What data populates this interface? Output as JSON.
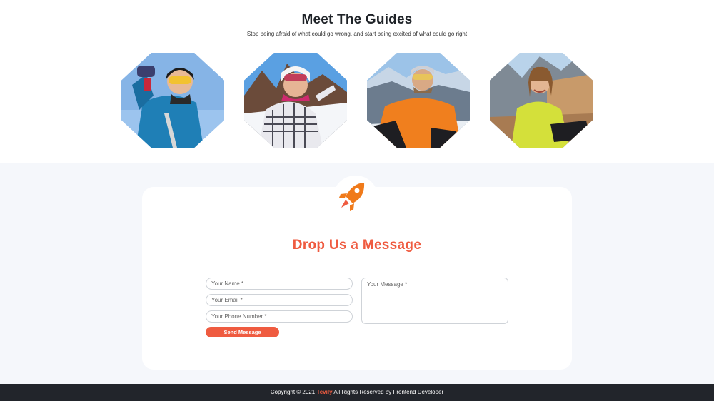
{
  "guides": {
    "title": "Meet The Guides",
    "subtitle": "Stop being afraid of what could go wrong, and start being excited of what could go right",
    "photos": [
      {
        "name": "guide-photo-1"
      },
      {
        "name": "guide-photo-2"
      },
      {
        "name": "guide-photo-3"
      },
      {
        "name": "guide-photo-4"
      }
    ]
  },
  "contact": {
    "icon": "rocket-icon",
    "title": "Drop Us a Message",
    "name_placeholder": "Your Name *",
    "email_placeholder": "Your Email *",
    "phone_placeholder": "Your Phone Number *",
    "message_placeholder": "Your Message *",
    "send_label": "Send Message"
  },
  "footer": {
    "prefix": "Copyright © 2021",
    "brand": "Tevily",
    "suffix": "All Rights Reserved by Frontend Developer"
  },
  "colors": {
    "accent": "#ef5b40",
    "footer_bg": "#22252b",
    "section_bg": "#f5f7fb"
  }
}
